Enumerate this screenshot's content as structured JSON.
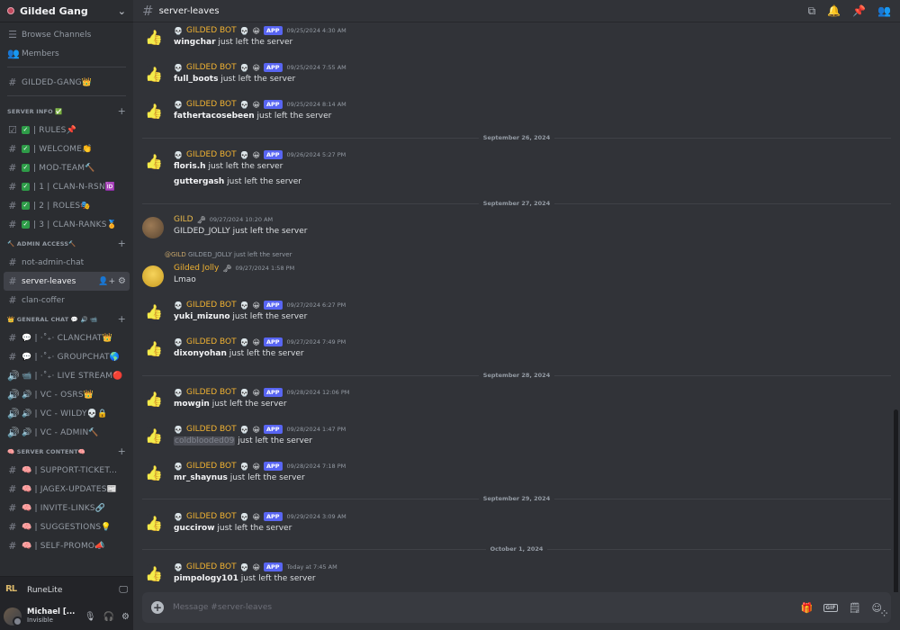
{
  "server": {
    "name": "Gilded Gang"
  },
  "sidebar": {
    "top_items": [
      {
        "label": "Browse Channels"
      },
      {
        "label": "Members"
      }
    ],
    "gilded_gang": "GILDED-GANG👑",
    "cat_server_info": "SERVER INFO ✅",
    "server_info_channels": [
      {
        "label": "| RULES📌"
      },
      {
        "label": "| WELCOME👏"
      },
      {
        "label": "| MOD-TEAM🔨"
      },
      {
        "label": "| 1 | CLAN-N-RSN🆔"
      },
      {
        "label": "| 2 | ROLES🎭"
      },
      {
        "label": "| 3 | CLAN-RANKS🏅"
      }
    ],
    "cat_admin": "🔨 ADMIN ACCESS🔨",
    "admin_channels": [
      {
        "label": "not-admin-chat"
      },
      {
        "label": "server-leaves"
      },
      {
        "label": "clan-coffer"
      }
    ],
    "cat_general": "👑 GENERAL CHAT 💬 🔊 📹",
    "general_channels": [
      {
        "icon": "#",
        "label": "💬 | ⋅˚₊‧ CLANCHAT👑"
      },
      {
        "icon": "#",
        "label": "💬 | ⋅˚₊‧ GROUPCHAT🌎"
      },
      {
        "icon": "🔊",
        "label": "📹 | ⋅˚₊‧ LIVE STREAM🔴"
      },
      {
        "icon": "🔊",
        "label": "🔊 | VC - OSRS👑"
      },
      {
        "icon": "🔊",
        "label": "🔊 | VC - WILDY💀🔒"
      },
      {
        "icon": "🔊",
        "label": "🔊 | VC - ADMIN🔨"
      }
    ],
    "cat_content": "🧠 SERVER CONTENT🧠",
    "content_channels": [
      {
        "label": "🧠 | SUPPORT-TICKET..."
      },
      {
        "label": "🧠 | JAGEX-UPDATES📰"
      },
      {
        "label": "🧠 | INVITE-LINKS🔗"
      },
      {
        "label": "🧠 | SUGGESTIONS💡"
      },
      {
        "label": "🧠 | SELF-PROMO📣"
      }
    ],
    "runelite": "RuneLite",
    "user": {
      "name": "Michael [...",
      "status": "Invisible"
    }
  },
  "channel": {
    "name": "server-leaves"
  },
  "bot_name": "GILDED BOT",
  "app_tag": "APP",
  "left_text": "just left the server",
  "messages": [
    {
      "user": "wingchar",
      "time": "09/25/2024 4:30 AM"
    },
    {
      "user": "full_boots",
      "time": "09/25/2024 7:55 AM"
    },
    {
      "user": "fathertacosebeen",
      "time": "09/25/2024 8:14 AM"
    },
    {
      "user": "floris.h",
      "time": "09/26/2024 5:27 PM",
      "extra_user": "guttergash"
    },
    {
      "user": "yuki_mizuno",
      "time": "09/27/2024 6:27 PM"
    },
    {
      "user": "dixonyohan",
      "time": "09/27/2024 7:49 PM"
    },
    {
      "user": "mowgin",
      "time": "09/28/2024 12:06 PM"
    },
    {
      "user": "coldblooded09",
      "time": "09/28/2024 1:47 PM"
    },
    {
      "user": "mr_shaynus",
      "time": "09/28/2024 7:18 PM"
    },
    {
      "user": "guccirow",
      "time": "09/29/2024 3:09 AM"
    },
    {
      "user": "pimpology101",
      "time": "Today at 7:45 AM"
    }
  ],
  "dates": {
    "d26": "September 26, 2024",
    "d27": "September 27, 2024",
    "d28": "September 28, 2024",
    "d29": "September 29, 2024",
    "oct1": "October 1, 2024"
  },
  "gild_msg": {
    "author": "GILD",
    "time": "09/27/2024 10:20 AM",
    "text": "GILDED_JOLLY just left the server"
  },
  "jolly_msg": {
    "reply_mention": "@GILD",
    "reply_text": "GILDED_JOLLY just left the server",
    "author": "Gilded Jolly",
    "time": "09/27/2024 1:58 PM",
    "text": "Lmao"
  },
  "composer": {
    "placeholder": "Message #server-leaves"
  },
  "colors": {
    "accent": "#5865f2",
    "bot_name": "#f0b232",
    "background": "#313338",
    "sidebar": "#2b2d31"
  }
}
